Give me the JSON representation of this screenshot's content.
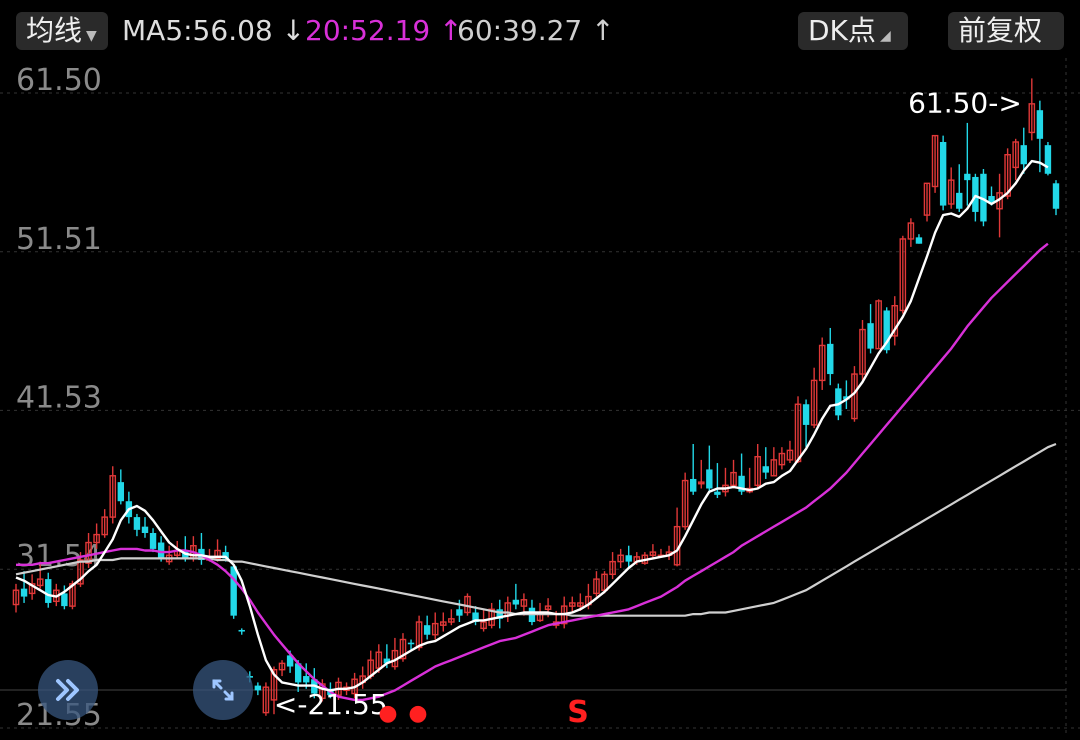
{
  "toolbar": {
    "ma_button": "均线",
    "ma5": {
      "label": "MA5:56.08",
      "arrow": "↓",
      "color": "#ffffff"
    },
    "ma20": {
      "label": "20:52.19",
      "arrow": "↑",
      "color": "#d830d8"
    },
    "ma60": {
      "label": "60:39.27",
      "arrow": "↑",
      "color": "#cfcfcf"
    },
    "dk_button": "DK点",
    "adjust_button": "前复权"
  },
  "colors": {
    "up": "#e03838",
    "down": "#22d8e8",
    "ma5": "#ffffff",
    "ma20": "#d830d8",
    "ma60": "#cfcfcf",
    "signal": "#ff2020"
  },
  "chart_data": {
    "type": "candlestick",
    "y_ticks": [
      "61.50",
      "51.51",
      "41.53",
      "31.54",
      "21.55"
    ],
    "ylim": [
      21.55,
      61.5
    ],
    "max_label": "61.50->",
    "min_label": "<-21.55",
    "signals": [
      "●",
      "●",
      "S"
    ],
    "candles": [
      [
        28.5,
        29.4,
        28.0,
        29.8
      ],
      [
        29.5,
        29.0,
        28.6,
        30.6
      ],
      [
        29.2,
        29.8,
        28.8,
        30.4
      ],
      [
        29.7,
        30.1,
        29.5,
        31.2
      ],
      [
        30.1,
        28.6,
        28.3,
        30.5
      ],
      [
        28.7,
        29.4,
        28.4,
        29.8
      ],
      [
        29.2,
        28.4,
        28.2,
        29.7
      ],
      [
        28.4,
        29.8,
        28.2,
        30.0
      ],
      [
        29.8,
        31.3,
        29.6,
        31.8
      ],
      [
        31.1,
        32.4,
        30.8,
        33.0
      ],
      [
        32.4,
        32.9,
        32.0,
        33.6
      ],
      [
        32.9,
        34.0,
        32.7,
        34.5
      ],
      [
        34.0,
        36.6,
        33.6,
        37.2
      ],
      [
        36.2,
        35.0,
        34.8,
        37.0
      ],
      [
        35.0,
        34.0,
        33.6,
        35.6
      ],
      [
        34.0,
        33.2,
        32.8,
        34.2
      ],
      [
        33.4,
        33.0,
        32.7,
        34.0
      ],
      [
        33.0,
        32.0,
        31.8,
        33.3
      ],
      [
        32.4,
        31.4,
        31.2,
        32.8
      ],
      [
        31.2,
        31.6,
        31.0,
        32.2
      ],
      [
        31.6,
        31.9,
        31.4,
        32.5
      ],
      [
        31.9,
        31.4,
        31.2,
        32.8
      ],
      [
        31.4,
        32.2,
        31.2,
        32.8
      ],
      [
        32.0,
        31.3,
        31.0,
        33.0
      ],
      [
        31.3,
        31.5,
        31.2,
        32.0
      ],
      [
        31.4,
        31.9,
        31.2,
        32.6
      ],
      [
        31.8,
        31.4,
        31.2,
        32.2
      ],
      [
        30.9,
        27.8,
        27.6,
        31.0
      ],
      [
        26.9,
        26.8,
        26.6,
        27.0
      ],
      [
        24.0,
        23.9,
        23.6,
        24.3
      ],
      [
        23.4,
        23.1,
        22.8,
        23.6
      ],
      [
        21.7,
        23.3,
        21.5,
        23.6
      ],
      [
        22.5,
        24.4,
        21.6,
        24.6
      ],
      [
        24.4,
        24.8,
        24.0,
        25.0
      ],
      [
        25.3,
        24.6,
        24.2,
        25.6
      ],
      [
        24.8,
        23.6,
        23.0,
        25.0
      ],
      [
        24.0,
        23.6,
        23.2,
        24.8
      ],
      [
        23.8,
        22.9,
        22.6,
        24.5
      ],
      [
        22.6,
        23.5,
        22.4,
        23.8
      ],
      [
        23.2,
        22.8,
        22.6,
        23.6
      ],
      [
        22.8,
        23.6,
        22.5,
        23.9
      ],
      [
        23.1,
        23.3,
        22.8,
        23.6
      ],
      [
        22.9,
        23.8,
        22.6,
        24.2
      ],
      [
        23.6,
        24.0,
        23.2,
        24.6
      ],
      [
        24.0,
        25.0,
        23.8,
        25.6
      ],
      [
        24.5,
        25.5,
        24.2,
        26.0
      ],
      [
        25.1,
        24.8,
        24.5,
        26.0
      ],
      [
        24.6,
        25.6,
        24.4,
        26.4
      ],
      [
        25.1,
        26.3,
        24.9,
        26.7
      ],
      [
        26.1,
        26.0,
        25.6,
        26.3
      ],
      [
        25.8,
        27.4,
        25.6,
        27.8
      ],
      [
        27.2,
        26.6,
        26.3,
        27.8
      ],
      [
        26.6,
        27.3,
        26.3,
        28.0
      ],
      [
        27.2,
        27.4,
        26.8,
        28.0
      ],
      [
        27.4,
        27.6,
        27.2,
        28.2
      ],
      [
        28.2,
        27.8,
        27.4,
        28.8
      ],
      [
        28.0,
        29.0,
        27.8,
        29.2
      ],
      [
        28.0,
        27.4,
        27.2,
        28.4
      ],
      [
        27.0,
        27.4,
        26.8,
        28.2
      ],
      [
        27.2,
        28.2,
        27.0,
        28.6
      ],
      [
        28.2,
        27.6,
        27.0,
        28.8
      ],
      [
        27.8,
        28.6,
        27.4,
        29.0
      ],
      [
        28.8,
        28.5,
        28.2,
        29.8
      ],
      [
        28.4,
        28.8,
        27.8,
        29.2
      ],
      [
        28.3,
        27.4,
        27.2,
        28.8
      ],
      [
        27.5,
        28.0,
        27.4,
        28.6
      ],
      [
        28.2,
        28.4,
        27.7,
        28.9
      ],
      [
        27.2,
        27.4,
        27.0,
        28.1
      ],
      [
        27.3,
        28.4,
        27.0,
        29.0
      ],
      [
        28.4,
        28.6,
        28.0,
        29.0
      ],
      [
        28.4,
        28.6,
        28.1,
        29.2
      ],
      [
        28.5,
        29.0,
        28.2,
        29.8
      ],
      [
        29.2,
        30.1,
        29.0,
        30.6
      ],
      [
        29.4,
        30.4,
        29.2,
        30.6
      ],
      [
        30.4,
        31.2,
        30.1,
        31.8
      ],
      [
        31.2,
        31.6,
        30.8,
        32.0
      ],
      [
        31.6,
        31.2,
        30.8,
        32.2
      ],
      [
        31.2,
        31.5,
        31.0,
        31.8
      ],
      [
        31.1,
        31.6,
        31.0,
        31.8
      ],
      [
        31.6,
        31.8,
        31.4,
        32.3
      ],
      [
        31.6,
        31.6,
        31.5,
        32.0
      ],
      [
        31.6,
        31.8,
        31.3,
        32.2
      ],
      [
        31.0,
        33.4,
        30.9,
        34.6
      ],
      [
        33.4,
        36.3,
        33.2,
        36.8
      ],
      [
        36.4,
        35.6,
        35.4,
        38.6
      ],
      [
        36.1,
        36.2,
        35.8,
        37.6
      ],
      [
        37.0,
        35.8,
        35.6,
        38.5
      ],
      [
        35.6,
        35.4,
        35.2,
        37.4
      ],
      [
        35.6,
        36.0,
        35.3,
        37.1
      ],
      [
        36.0,
        36.8,
        35.8,
        37.6
      ],
      [
        36.6,
        35.6,
        35.4,
        38.0
      ],
      [
        35.6,
        35.8,
        35.5,
        37.1
      ],
      [
        36.0,
        37.8,
        35.8,
        38.6
      ],
      [
        37.2,
        36.8,
        36.4,
        38.4
      ],
      [
        36.6,
        37.6,
        36.6,
        38.4
      ],
      [
        37.3,
        38.0,
        37.0,
        38.4
      ],
      [
        37.6,
        38.2,
        37.4,
        38.8
      ],
      [
        37.5,
        41.1,
        37.4,
        41.6
      ],
      [
        41.1,
        39.8,
        38.4,
        41.4
      ],
      [
        39.8,
        42.6,
        39.6,
        43.4
      ],
      [
        42.6,
        44.8,
        42.0,
        45.3
      ],
      [
        44.9,
        43.0,
        42.3,
        45.9
      ],
      [
        42.1,
        40.4,
        40.1,
        42.4
      ],
      [
        41.6,
        41.4,
        40.8,
        42.6
      ],
      [
        40.2,
        43.0,
        40.0,
        43.5
      ],
      [
        43.0,
        45.8,
        42.6,
        46.4
      ],
      [
        46.2,
        44.6,
        44.3,
        47.4
      ],
      [
        44.6,
        47.6,
        44.6,
        47.7
      ],
      [
        47.0,
        44.5,
        44.3,
        47.2
      ],
      [
        45.4,
        47.3,
        44.8,
        47.9
      ],
      [
        47.0,
        51.5,
        46.8,
        51.7
      ],
      [
        51.5,
        52.5,
        51.0,
        52.8
      ],
      [
        51.6,
        51.2,
        51.2,
        51.8
      ],
      [
        53.0,
        55.0,
        52.6,
        55.0
      ],
      [
        54.8,
        58.0,
        54.4,
        58.0
      ],
      [
        57.6,
        53.6,
        53.3,
        58.0
      ],
      [
        53.7,
        55.2,
        53.4,
        56.0
      ],
      [
        54.4,
        53.4,
        53.2,
        56.2
      ],
      [
        55.6,
        55.2,
        53.6,
        58.8
      ],
      [
        55.4,
        53.2,
        52.6,
        55.6
      ],
      [
        55.6,
        52.6,
        52.3,
        55.9
      ],
      [
        54.2,
        53.8,
        53.6,
        54.8
      ],
      [
        53.4,
        54.4,
        51.6,
        55.6
      ],
      [
        54.2,
        56.8,
        54.0,
        57.2
      ],
      [
        56.0,
        57.6,
        55.2,
        57.8
      ],
      [
        57.4,
        56.2,
        55.6,
        58.5
      ],
      [
        58.2,
        60.0,
        57.7,
        61.6
      ],
      [
        59.6,
        57.8,
        55.7,
        60.2
      ],
      [
        57.4,
        55.6,
        55.5,
        57.6
      ],
      [
        55.0,
        53.4,
        53.0,
        55.2
      ]
    ],
    "ma5": [
      30.2,
      30.0,
      29.7,
      29.4,
      29.1,
      29.0,
      29.3,
      29.7,
      30.1,
      30.6,
      31.0,
      31.8,
      32.6,
      33.8,
      34.5,
      34.7,
      34.4,
      33.8,
      33.1,
      32.4,
      32.0,
      31.7,
      31.6,
      31.6,
      31.5,
      31.5,
      31.5,
      31.0,
      30.0,
      28.4,
      26.6,
      25.0,
      24.1,
      23.6,
      23.5,
      23.4,
      23.4,
      23.4,
      23.2,
      23.1,
      23.2,
      23.2,
      23.3,
      23.6,
      24.0,
      24.4,
      24.8,
      25.0,
      25.3,
      25.6,
      25.9,
      26.1,
      26.2,
      26.5,
      26.8,
      27.1,
      27.3,
      27.5,
      27.5,
      27.6,
      27.7,
      27.8,
      27.9,
      28.0,
      28.0,
      28.0,
      28.0,
      27.9,
      27.9,
      28.0,
      28.2,
      28.5,
      28.9,
      29.3,
      29.8,
      30.3,
      30.8,
      31.2,
      31.3,
      31.4,
      31.5,
      31.6,
      31.9,
      32.8,
      33.8,
      34.8,
      35.6,
      35.8,
      35.8,
      35.9,
      35.8,
      35.7,
      35.8,
      36.1,
      36.2,
      36.6,
      36.9,
      37.6,
      38.3,
      39.2,
      40.2,
      41.0,
      41.1,
      41.4,
      41.8,
      42.5,
      43.4,
      44.3,
      45.0,
      45.8,
      46.6,
      47.6,
      49.0,
      50.4,
      51.9,
      53.0,
      53.1,
      52.9,
      53.4,
      54.2,
      54.0,
      53.7,
      54.0,
      54.4,
      55.0,
      55.8,
      56.4,
      56.3,
      56.0
    ],
    "ma20": [
      31.0,
      31.0,
      31.0,
      31.1,
      31.1,
      31.2,
      31.3,
      31.4,
      31.5,
      31.6,
      31.7,
      31.8,
      31.9,
      32.0,
      32.0,
      32.0,
      31.9,
      31.9,
      31.8,
      31.8,
      31.9,
      31.9,
      31.8,
      31.6,
      31.3,
      31.0,
      30.6,
      30.1,
      29.5,
      28.8,
      28.0,
      27.3,
      26.6,
      26.0,
      25.4,
      24.8,
      24.3,
      23.8,
      23.4,
      23.0,
      22.7,
      22.6,
      22.5,
      22.5,
      22.6,
      22.7,
      22.9,
      23.1,
      23.4,
      23.7,
      24.0,
      24.3,
      24.6,
      24.8,
      25.0,
      25.2,
      25.4,
      25.6,
      25.8,
      26.0,
      26.2,
      26.3,
      26.4,
      26.6,
      26.8,
      27.0,
      27.2,
      27.3,
      27.4,
      27.5,
      27.6,
      27.7,
      27.8,
      27.9,
      28.0,
      28.1,
      28.2,
      28.4,
      28.6,
      28.8,
      29.0,
      29.3,
      29.6,
      30.0,
      30.3,
      30.6,
      30.9,
      31.2,
      31.5,
      31.8,
      32.2,
      32.5,
      32.8,
      33.1,
      33.4,
      33.7,
      34.0,
      34.3,
      34.6,
      35.0,
      35.4,
      35.8,
      36.3,
      36.8,
      37.4,
      38.0,
      38.6,
      39.2,
      39.8,
      40.4,
      41.0,
      41.6,
      42.2,
      42.8,
      43.4,
      44.0,
      44.6,
      45.3,
      46.0,
      46.6,
      47.2,
      47.8,
      48.3,
      48.8,
      49.3,
      49.8,
      50.3,
      50.8,
      51.2
    ],
    "ma60": [
      30.4,
      30.5,
      30.6,
      30.7,
      30.8,
      30.9,
      31.0,
      31.1,
      31.2,
      31.2,
      31.3,
      31.3,
      31.3,
      31.4,
      31.4,
      31.4,
      31.4,
      31.4,
      31.4,
      31.4,
      31.4,
      31.4,
      31.4,
      31.4,
      31.4,
      31.3,
      31.3,
      31.2,
      31.2,
      31.1,
      31.0,
      30.9,
      30.8,
      30.7,
      30.6,
      30.5,
      30.4,
      30.3,
      30.2,
      30.1,
      30.0,
      29.9,
      29.8,
      29.7,
      29.6,
      29.5,
      29.4,
      29.3,
      29.2,
      29.1,
      29.0,
      28.9,
      28.8,
      28.7,
      28.6,
      28.5,
      28.4,
      28.3,
      28.2,
      28.1,
      28.0,
      28.0,
      27.9,
      27.9,
      27.9,
      27.9,
      27.9,
      27.9,
      27.9,
      27.8,
      27.8,
      27.8,
      27.8,
      27.8,
      27.8,
      27.8,
      27.8,
      27.8,
      27.8,
      27.8,
      27.8,
      27.8,
      27.8,
      27.8,
      27.9,
      27.9,
      28.0,
      28.0,
      28.0,
      28.1,
      28.2,
      28.3,
      28.4,
      28.5,
      28.6,
      28.8,
      29.0,
      29.2,
      29.4,
      29.7,
      30.0,
      30.3,
      30.6,
      30.9,
      31.2,
      31.5,
      31.8,
      32.1,
      32.4,
      32.7,
      33.0,
      33.3,
      33.6,
      33.9,
      34.2,
      34.5,
      34.8,
      35.1,
      35.4,
      35.7,
      36.0,
      36.3,
      36.6,
      36.9,
      37.2,
      37.5,
      37.8,
      38.1,
      38.4,
      38.6
    ]
  }
}
